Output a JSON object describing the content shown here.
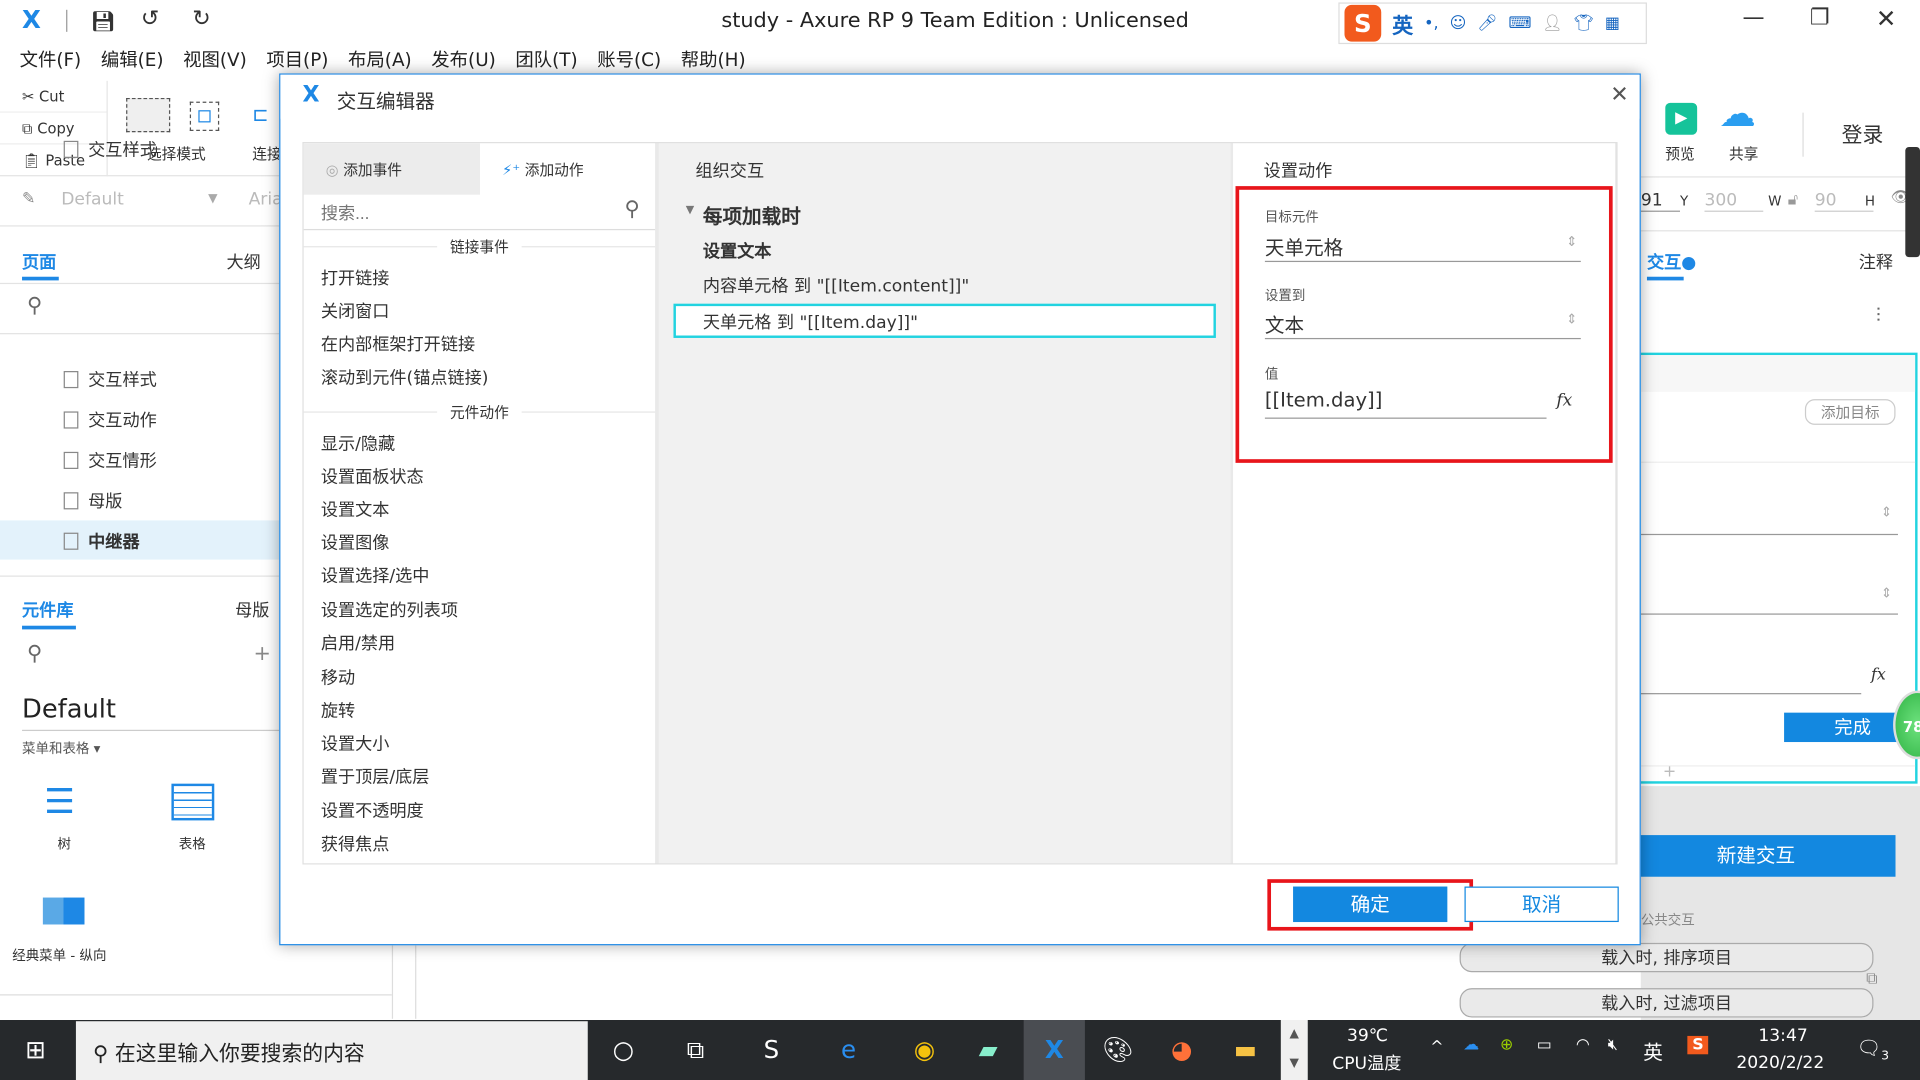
{
  "window": {
    "title": "study - Axure RP 9 Team Edition : Unlicensed"
  },
  "menu": [
    "文件(F)",
    "编辑(E)",
    "视图(V)",
    "项目(P)",
    "布局(A)",
    "发布(U)",
    "团队(T)",
    "账号(C)",
    "帮助(H)"
  ],
  "ime": {
    "lang": "英"
  },
  "toolbar": {
    "cut": "Cut",
    "copy": "Copy",
    "paste": "Paste",
    "select_mode": "选择模式",
    "connect": "连接",
    "preview": "预览",
    "share": "共享",
    "login": "登录"
  },
  "stylebar": {
    "style": "Default",
    "font": "Aria"
  },
  "left": {
    "tabs": [
      "页面",
      "大纲"
    ],
    "pages": [
      "交互样式",
      "交互动作",
      "交互情形",
      "母版",
      "中继器"
    ],
    "selected_page": "中继器",
    "lib_tabs": [
      "元件库",
      "母版"
    ],
    "library": "Default",
    "category": "菜单和表格 ▾",
    "widgets": [
      "树",
      "表格",
      "经典菜单 - 纵向"
    ]
  },
  "right": {
    "coords": {
      "x": "91",
      "y_label": "Y",
      "w": "300",
      "w_label": "W",
      "h": "90",
      "h_label": "H"
    },
    "tabs": {
      "interaction": "交互",
      "notes": "注释"
    },
    "add_target": "添加目标",
    "done": "完成",
    "badge": "78",
    "new_interaction": "新建交互",
    "public_interaction": "公共交互",
    "public_items": [
      "载入时, 排序项目",
      "载入时, 过滤项目"
    ]
  },
  "dialog": {
    "title": "交互编辑器",
    "tabs": {
      "add_event": "添加事件",
      "add_action": "添加动作"
    },
    "search_placeholder": "搜索...",
    "sections": [
      {
        "title": "链接事件",
        "items": [
          "打开链接",
          "关闭窗口",
          "在内部框架打开链接",
          "滚动到元件(锚点链接)"
        ]
      },
      {
        "title": "元件动作",
        "items": [
          "显示/隐藏",
          "设置面板状态",
          "设置文本",
          "设置图像",
          "设置选择/选中",
          "设置选定的列表项",
          "启用/禁用",
          "移动",
          "旋转",
          "设置大小",
          "置于顶层/底层",
          "设置不透明度",
          "获得焦点"
        ]
      }
    ],
    "organize": {
      "title": "组织交互",
      "event": "每项加载时",
      "action": "设置文本",
      "rows": [
        "内容单元格 到 \"[[Item.content]]\"",
        "天单元格 到 \"[[Item.day]]\""
      ],
      "selected_row": 1
    },
    "config": {
      "title": "设置动作",
      "target_label": "目标元件",
      "target": "天单元格",
      "set_to_label": "设置到",
      "set_to": "文本",
      "value_label": "值",
      "value": "[[Item.day]]"
    },
    "ok": "确定",
    "cancel": "取消"
  },
  "taskbar": {
    "search_placeholder": "在这里输入你要搜索的内容",
    "temp": "39℃",
    "temp_label": "CPU温度",
    "ime": "英",
    "time": "13:47",
    "date": "2020/2/22",
    "notifications": "3"
  },
  "colors": {
    "accent": "#1388e0",
    "highlight": "#e8151b",
    "selection": "#22d3e0"
  }
}
